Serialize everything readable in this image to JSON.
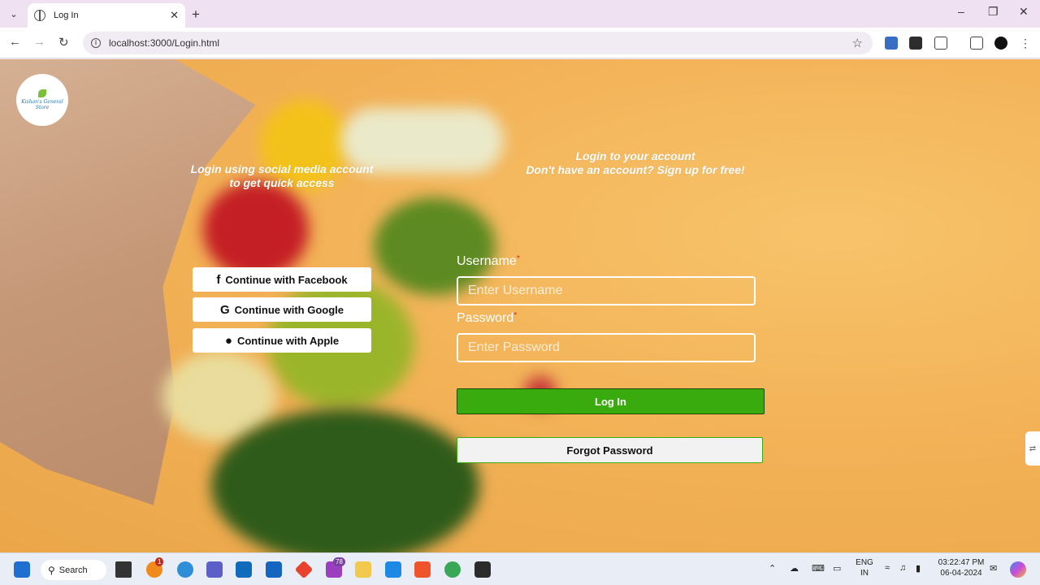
{
  "browser": {
    "tab_title": "Log In",
    "url": "localhost:3000/Login.html"
  },
  "logo": {
    "text": "Kishan's General Store"
  },
  "social": {
    "heading": "Login using social media account to get quick access",
    "facebook": "Continue with Facebook",
    "google": "Continue with Google",
    "apple": "Continue with Apple"
  },
  "login": {
    "heading_line1": "Login to your account",
    "heading_line2": "Don't have an account? Sign up for free!",
    "username_label": "Username",
    "username_placeholder": "Enter Username",
    "password_label": "Password",
    "password_placeholder": "Enter Password",
    "required_mark": "*",
    "login_button": "Log In",
    "forgot_button": "Forgot Password"
  },
  "taskbar": {
    "search_label": "Search",
    "badge_orange": "1",
    "badge_purple": "78",
    "lang_line1": "ENG",
    "lang_line2": "IN",
    "time": "03:22:47 PM",
    "date": "06-04-2024"
  },
  "colors": {
    "login_green": "#3aab0e",
    "background_orange": "#f3b257"
  }
}
